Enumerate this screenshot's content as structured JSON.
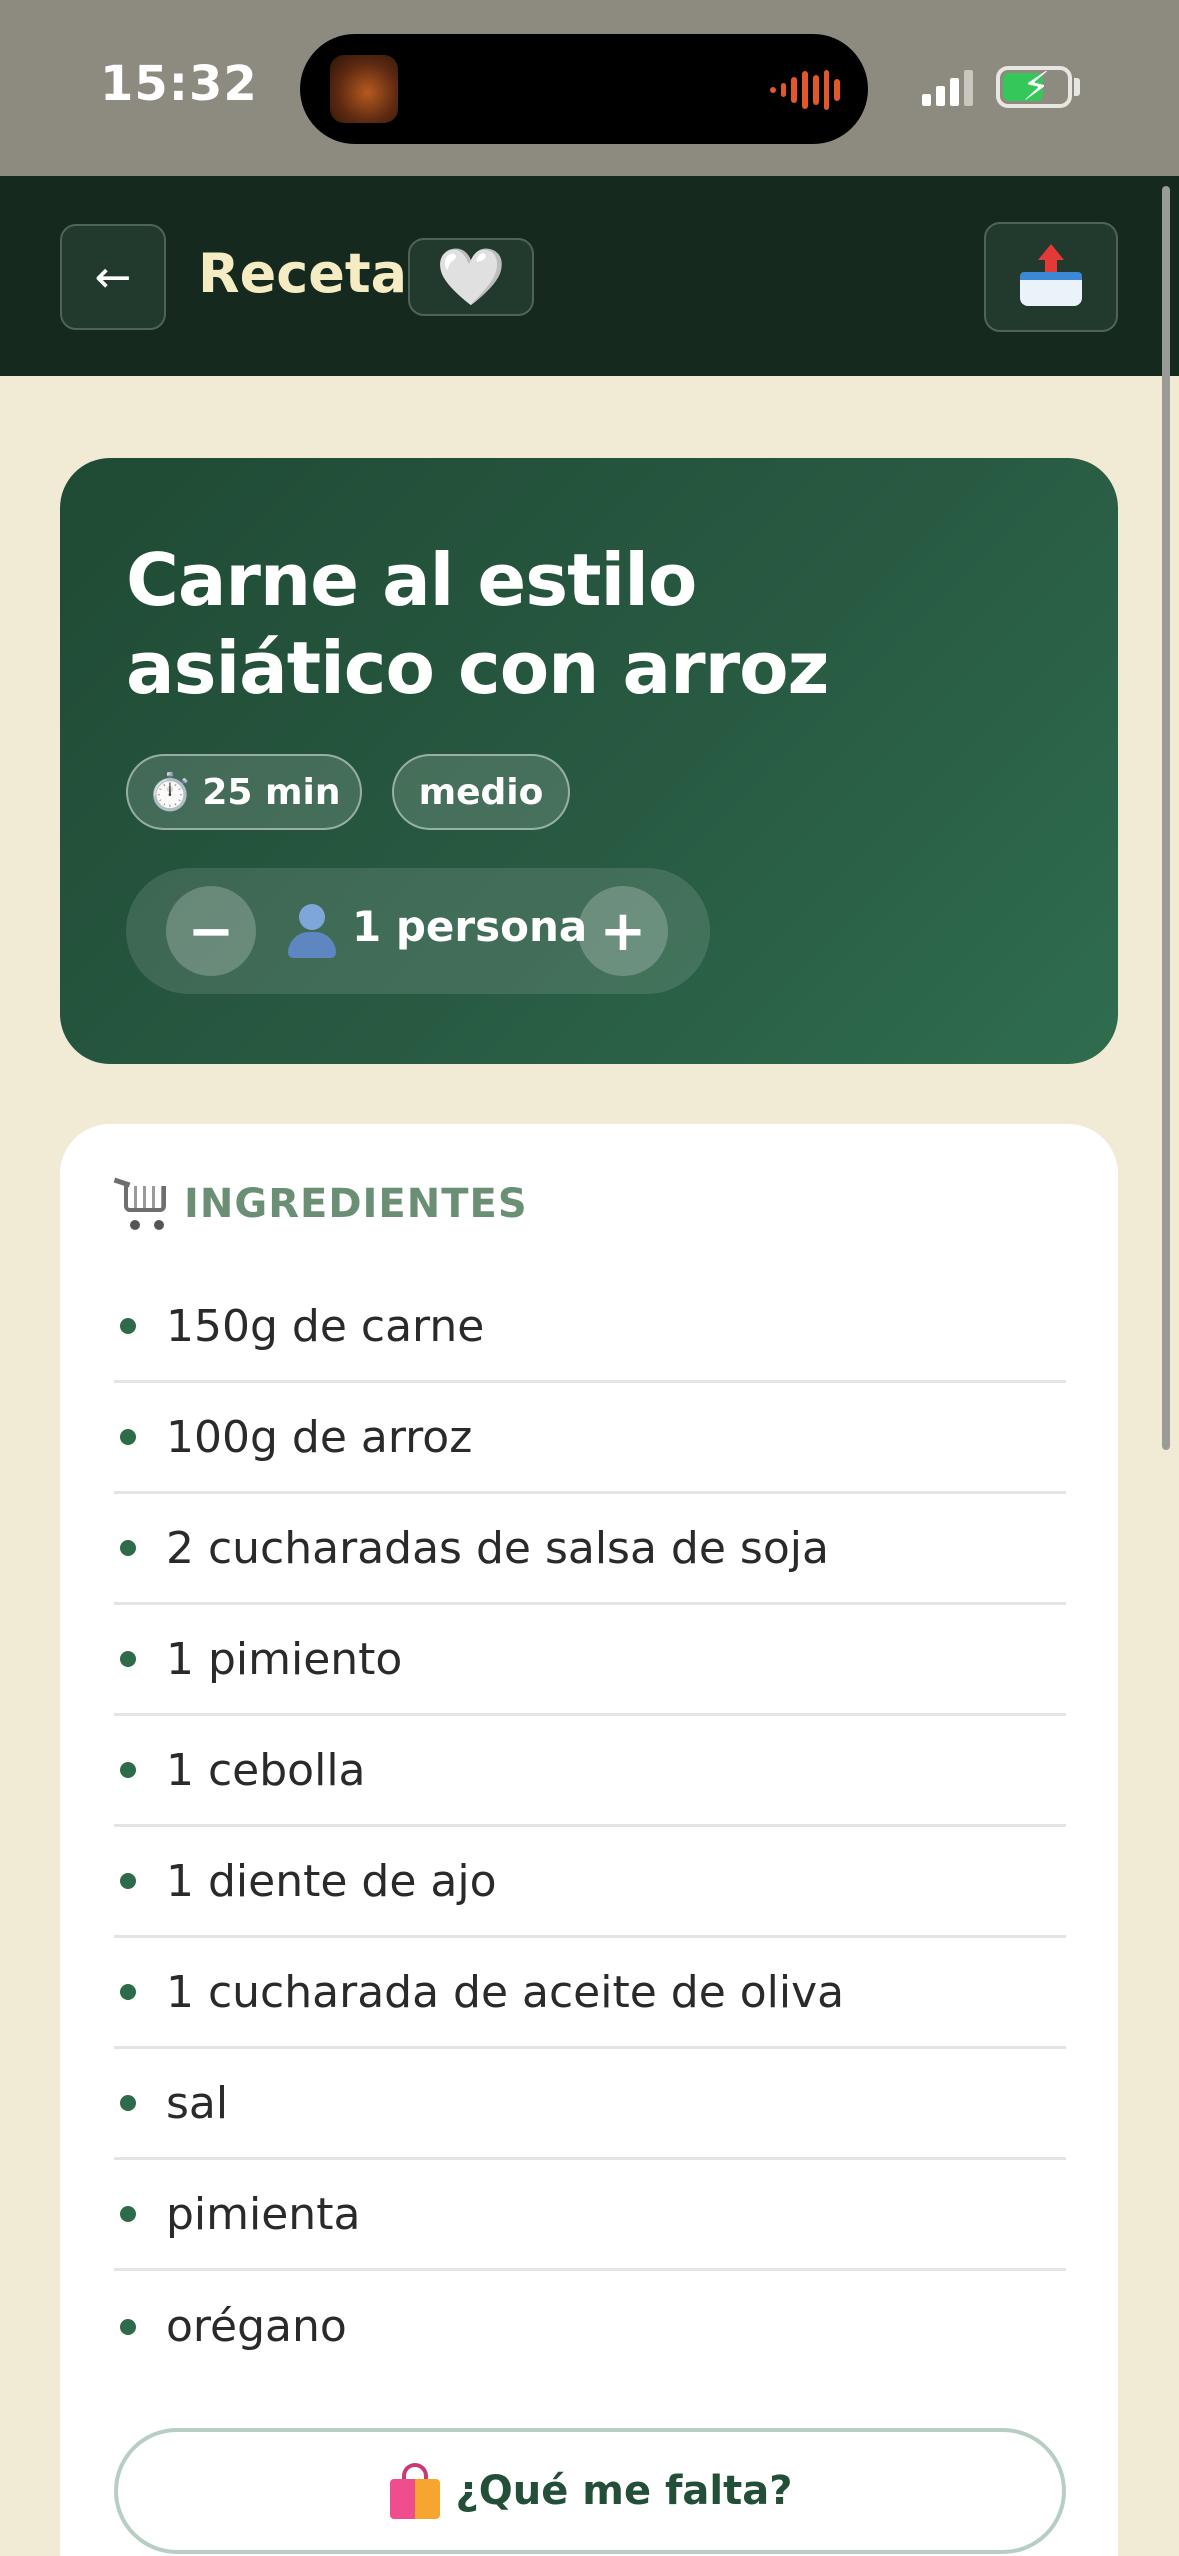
{
  "status_bar": {
    "time": "15:32",
    "icons": [
      "media-thumbnail-icon",
      "audio-wave-icon",
      "cellular-signal-icon",
      "battery-charging-icon"
    ],
    "battery_color": "#35c759"
  },
  "header": {
    "back_icon": "←",
    "title": "Receta",
    "favorite_icon": "🤍",
    "share_icon": "outbox-tray-icon"
  },
  "recipe": {
    "title": "Carne al estilo asiático con arroz",
    "time_icon": "⏱️",
    "time": "25 min",
    "difficulty": "medio",
    "portions": {
      "minus": "−",
      "plus": "+",
      "icon": "person-icon",
      "label": "1 persona"
    }
  },
  "ingredients": {
    "icon": "shopping-cart-icon",
    "title": "INGREDIENTES",
    "items": [
      "150g de carne",
      "100g de arroz",
      "2 cucharadas de salsa de soja",
      "1 pimiento",
      "1 cebolla",
      "1 diente de ajo",
      "1 cucharada de aceite de oliva",
      "sal",
      "pimienta",
      "orégano"
    ],
    "missing_button": {
      "icon": "shopping-bags-icon",
      "label": "¿Qué me falta?"
    }
  },
  "colors": {
    "header_bg": "#15291f",
    "hero_gradient_start": "#1f4a34",
    "hero_gradient_end": "#2f6d4e",
    "page_bg": "#f1ebd6",
    "accent_green": "#2e6b4a",
    "section_title": "#6a8f74"
  }
}
